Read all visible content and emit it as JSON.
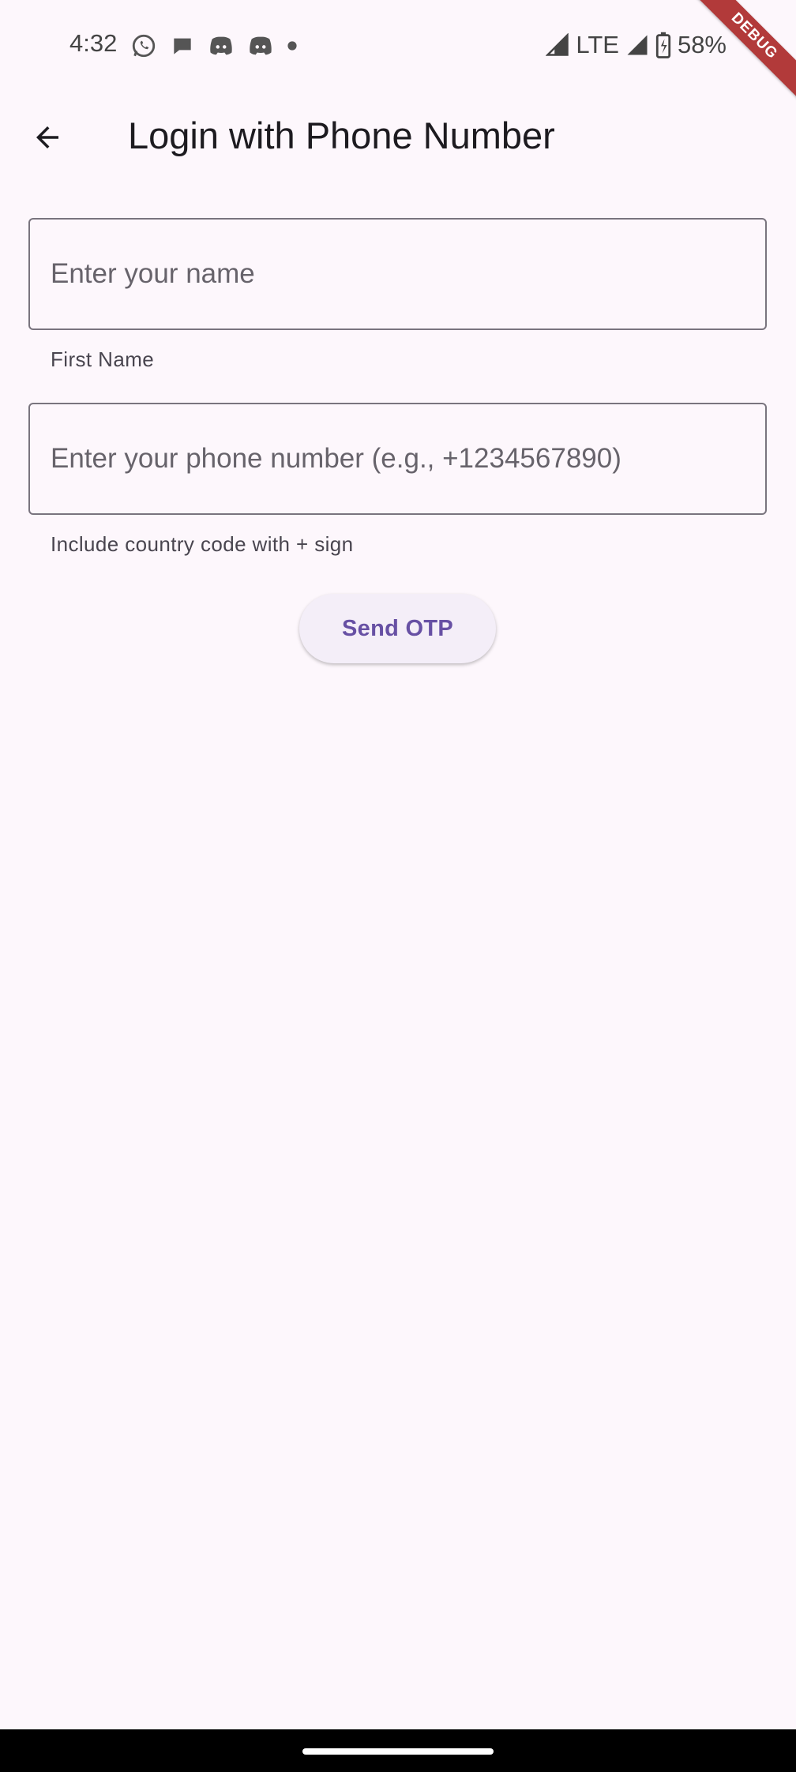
{
  "status_bar": {
    "time": "4:32",
    "notification_icons": [
      "whatsapp-icon",
      "chat-bubble-icon",
      "discord-icon",
      "discord-icon",
      "dot-icon"
    ],
    "network": "LTE",
    "battery": "58%"
  },
  "debug_banner": {
    "label": "DEBUG"
  },
  "app_bar": {
    "title": "Login with Phone Number",
    "back_icon": "arrow-back-icon"
  },
  "form": {
    "name_field": {
      "value": "",
      "placeholder": "Enter your name",
      "helper": "First Name"
    },
    "phone_field": {
      "value": "",
      "placeholder": "Enter your phone number (e.g., +1234567890)",
      "helper": "Include country code with + sign"
    },
    "send_button_label": "Send OTP"
  },
  "colors": {
    "background": "#fdf7fc",
    "primary": "#6750a4",
    "outline": "#79747e",
    "debug": "#b23a3a"
  }
}
